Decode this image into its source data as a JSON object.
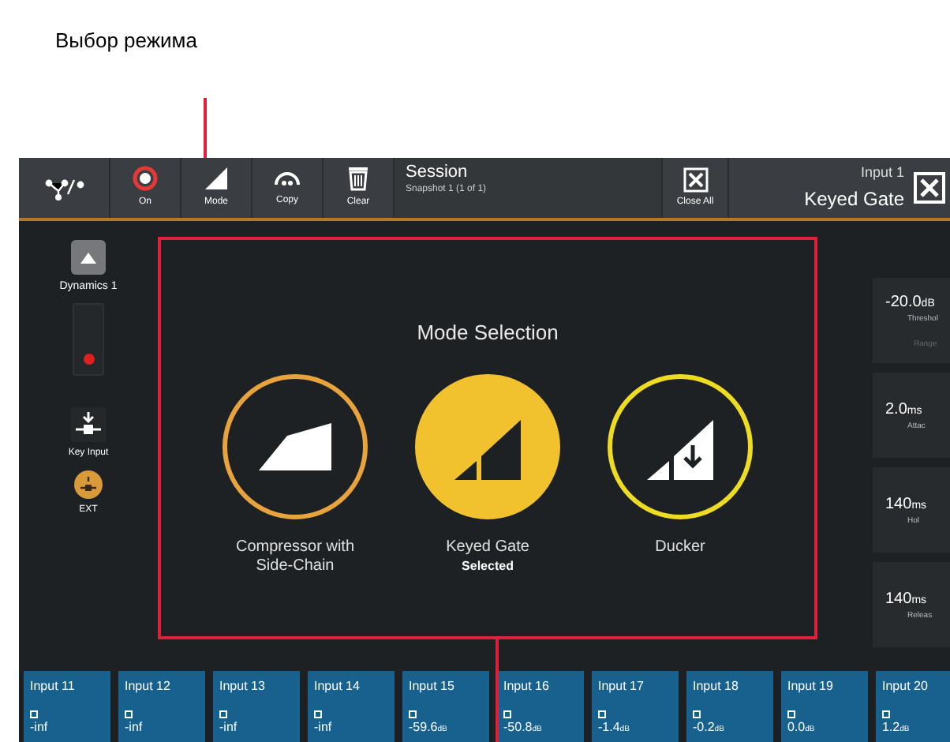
{
  "annotation": {
    "caption": "Выбор режима"
  },
  "toolbar": {
    "tools": [
      {
        "kind": "on",
        "label": "On"
      },
      {
        "kind": "mode",
        "label": "Mode"
      },
      {
        "kind": "copy",
        "label": "Copy"
      },
      {
        "kind": "clear",
        "label": "Clear"
      }
    ],
    "session": {
      "title": "Session",
      "subtitle": "Snapshot 1 (1 of 1)"
    },
    "close_all": "Close All",
    "channel": "Input 1",
    "mode": "Keyed Gate"
  },
  "sidebar": {
    "dynamics": "Dynamics 1",
    "key_input": "Key Input",
    "ext": "EXT"
  },
  "mode_selection": {
    "title": "Mode Selection",
    "modes": [
      {
        "kind": "compressor",
        "label": "Compressor with Side-Chain",
        "selected": false,
        "color": "#e8a33c"
      },
      {
        "kind": "gate",
        "label": "Keyed Gate",
        "selected": true,
        "status": "Selected",
        "color": "#f2c12e"
      },
      {
        "kind": "ducker",
        "label": "Ducker",
        "selected": false,
        "color": "#eedc22"
      }
    ]
  },
  "parameters": [
    {
      "value": "-20.0",
      "unit": "dB",
      "label": "Threshol",
      "extra": "Range"
    },
    {
      "value": "2.0",
      "unit": "ms",
      "label": "Attac"
    },
    {
      "value": "140",
      "unit": "ms",
      "label": "Hol"
    },
    {
      "value": "140",
      "unit": "ms",
      "label": "Releas"
    }
  ],
  "inputs": [
    {
      "name": "Input 11",
      "value": "-inf"
    },
    {
      "name": "Input 12",
      "value": "-inf"
    },
    {
      "name": "Input 13",
      "value": "-inf"
    },
    {
      "name": "Input 14",
      "value": "-inf"
    },
    {
      "name": "Input 15",
      "value": "-59.6",
      "unit": "dB"
    },
    {
      "name": "Input 16",
      "value": "-50.8",
      "unit": "dB"
    },
    {
      "name": "Input 17",
      "value": "-1.4",
      "unit": "dB"
    },
    {
      "name": "Input 18",
      "value": "-0.2",
      "unit": "dB"
    },
    {
      "name": "Input 19",
      "value": "0.0",
      "unit": "dB"
    },
    {
      "name": "Input 20",
      "value": "1.2",
      "unit": "dB"
    }
  ]
}
